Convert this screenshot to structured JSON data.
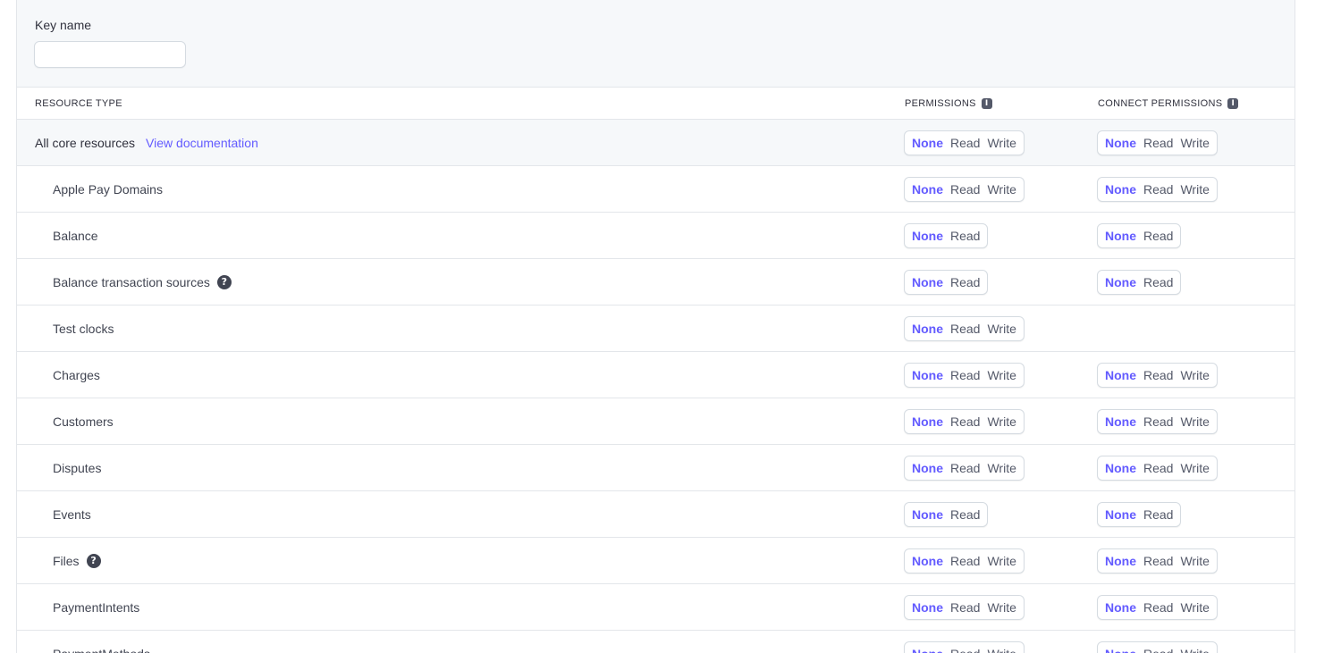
{
  "key_name": {
    "label": "Key name",
    "value": "",
    "placeholder": ""
  },
  "table": {
    "headers": {
      "resource_type": "RESOURCE TYPE",
      "permissions": "PERMISSIONS",
      "connect_permissions": "CONNECT PERMISSIONS"
    },
    "core_row": {
      "label": "All core resources",
      "link": "View documentation",
      "permissions": {
        "options": [
          "None",
          "Read",
          "Write"
        ],
        "selected": "None"
      },
      "connect": {
        "options": [
          "None",
          "Read",
          "Write"
        ],
        "selected": "None"
      }
    },
    "rows": [
      {
        "label": "Apple Pay Domains",
        "help": false,
        "permissions": {
          "options": [
            "None",
            "Read",
            "Write"
          ],
          "selected": "None"
        },
        "connect": {
          "options": [
            "None",
            "Read",
            "Write"
          ],
          "selected": "None"
        }
      },
      {
        "label": "Balance",
        "help": false,
        "permissions": {
          "options": [
            "None",
            "Read"
          ],
          "selected": "None"
        },
        "connect": {
          "options": [
            "None",
            "Read"
          ],
          "selected": "None"
        }
      },
      {
        "label": "Balance transaction sources",
        "help": true,
        "permissions": {
          "options": [
            "None",
            "Read"
          ],
          "selected": "None"
        },
        "connect": {
          "options": [
            "None",
            "Read"
          ],
          "selected": "None"
        }
      },
      {
        "label": "Test clocks",
        "help": false,
        "permissions": {
          "options": [
            "None",
            "Read",
            "Write"
          ],
          "selected": "None"
        },
        "connect": null
      },
      {
        "label": "Charges",
        "help": false,
        "permissions": {
          "options": [
            "None",
            "Read",
            "Write"
          ],
          "selected": "None"
        },
        "connect": {
          "options": [
            "None",
            "Read",
            "Write"
          ],
          "selected": "None"
        }
      },
      {
        "label": "Customers",
        "help": false,
        "permissions": {
          "options": [
            "None",
            "Read",
            "Write"
          ],
          "selected": "None"
        },
        "connect": {
          "options": [
            "None",
            "Read",
            "Write"
          ],
          "selected": "None"
        }
      },
      {
        "label": "Disputes",
        "help": false,
        "permissions": {
          "options": [
            "None",
            "Read",
            "Write"
          ],
          "selected": "None"
        },
        "connect": {
          "options": [
            "None",
            "Read",
            "Write"
          ],
          "selected": "None"
        }
      },
      {
        "label": "Events",
        "help": false,
        "permissions": {
          "options": [
            "None",
            "Read"
          ],
          "selected": "None"
        },
        "connect": {
          "options": [
            "None",
            "Read"
          ],
          "selected": "None"
        }
      },
      {
        "label": "Files",
        "help": true,
        "permissions": {
          "options": [
            "None",
            "Read",
            "Write"
          ],
          "selected": "None"
        },
        "connect": {
          "options": [
            "None",
            "Read",
            "Write"
          ],
          "selected": "None"
        }
      },
      {
        "label": "PaymentIntents",
        "help": false,
        "permissions": {
          "options": [
            "None",
            "Read",
            "Write"
          ],
          "selected": "None"
        },
        "connect": {
          "options": [
            "None",
            "Read",
            "Write"
          ],
          "selected": "None"
        }
      },
      {
        "label": "PaymentMethods",
        "help": false,
        "permissions": {
          "options": [
            "None",
            "Read",
            "Write"
          ],
          "selected": "None"
        },
        "connect": {
          "options": [
            "None",
            "Read",
            "Write"
          ],
          "selected": "None"
        }
      }
    ]
  },
  "icons": {
    "info": "info-icon",
    "help": "question-circle-icon"
  },
  "colors": {
    "accent": "#635bff",
    "border": "#e3e6ea",
    "section_bg": "#f6f8fa",
    "text": "#30313d"
  }
}
